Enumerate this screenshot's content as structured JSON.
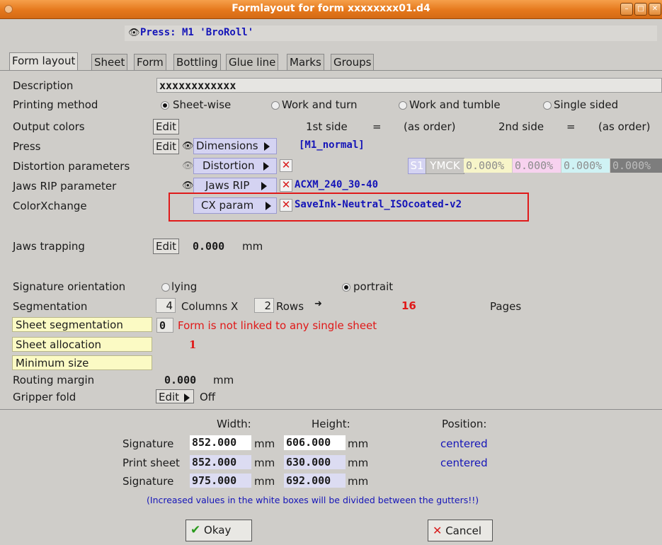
{
  "window": {
    "title": "Formlayout for form xxxxxxxx01.d4",
    "controls": [
      "–",
      "□",
      "✕"
    ]
  },
  "press": {
    "text": "Press: M1 'BroRoll'"
  },
  "tabs": [
    "Form layout",
    "Sheet",
    "Form",
    "Bottling",
    "Glue line",
    "Marks",
    "Groups"
  ],
  "rows": {
    "description": {
      "label": "Description",
      "value": "xxxxxxxxxxxx"
    },
    "printing_method": {
      "label": "Printing method",
      "options": [
        "Sheet-wise",
        "Work and turn",
        "Work and tumble",
        "Single sided"
      ],
      "selected": "Sheet-wise"
    },
    "output_colors": {
      "label": "Output colors",
      "edit": "Edit",
      "first_side": "1st side",
      "eq": "=",
      "first_value": "(as order)",
      "second_side": "2nd side",
      "second_value": "(as order)"
    },
    "press": {
      "label": "Press",
      "edit": "Edit",
      "button": "Dimensions",
      "value": "[M1_normal]"
    },
    "distortion": {
      "label": "Distortion parameters",
      "button": "Distortion",
      "s1": "S1",
      "ymck": "YMCK",
      "values": [
        "0.000%",
        "0.000%",
        "0.000%",
        "0.000%"
      ],
      "colors": [
        "#f7f5c9",
        "#f7d2ef",
        "#cff2f4",
        "#7d7d7d"
      ]
    },
    "jaws_rip": {
      "label": "Jaws RIP parameter",
      "button": "Jaws RIP",
      "value": "ACXM_240_30-40"
    },
    "colorxchange": {
      "label": "ColorXchange",
      "button": "CX param",
      "value": "SaveInk-Neutral_ISOcoated-v2"
    },
    "jaws_trapping": {
      "label": "Jaws trapping",
      "edit": "Edit",
      "value": "0.000",
      "unit": "mm"
    },
    "signature_orientation": {
      "label": "Signature orientation",
      "options": [
        "lying",
        "portrait"
      ],
      "selected": "portrait"
    },
    "segmentation": {
      "label": "Segmentation",
      "columns": "4",
      "columns_label": "Columns X",
      "rows": "2",
      "rows_label": "Rows",
      "pages": "16",
      "pages_label": "Pages"
    },
    "sheet_segmentation": {
      "label": "Sheet segmentation",
      "value": "0",
      "message": "Form is not linked to any single sheet"
    },
    "sheet_allocation": {
      "label": "Sheet allocation",
      "value": "1"
    },
    "minimum_size": {
      "label": "Minimum size"
    },
    "routing_margin": {
      "label": "Routing margin",
      "value": "0.000",
      "unit": "mm"
    },
    "gripper_fold": {
      "label": "Gripper fold",
      "edit": "Edit",
      "value": "Off"
    }
  },
  "sizes": {
    "headers": {
      "width": "Width:",
      "height": "Height:",
      "position": "Position:"
    },
    "rows": [
      {
        "label": "Signature",
        "width": "852.000",
        "height": "606.000",
        "unit": "mm",
        "position": "centered"
      },
      {
        "label": "Print sheet",
        "width": "852.000",
        "height": "630.000",
        "unit": "mm",
        "position": "centered"
      },
      {
        "label": "Signature",
        "width": "975.000",
        "height": "692.000",
        "unit": "mm",
        "position": ""
      }
    ],
    "note": "(Increased values in the white boxes will be divided between the gutters!!)"
  },
  "buttons": {
    "okay": "Okay",
    "cancel": "Cancel"
  },
  "colors": {
    "title_orange": "#e5781c",
    "link_blue": "#1515b8",
    "alert_red": "#e01818",
    "highlight": "#e01a1a"
  }
}
